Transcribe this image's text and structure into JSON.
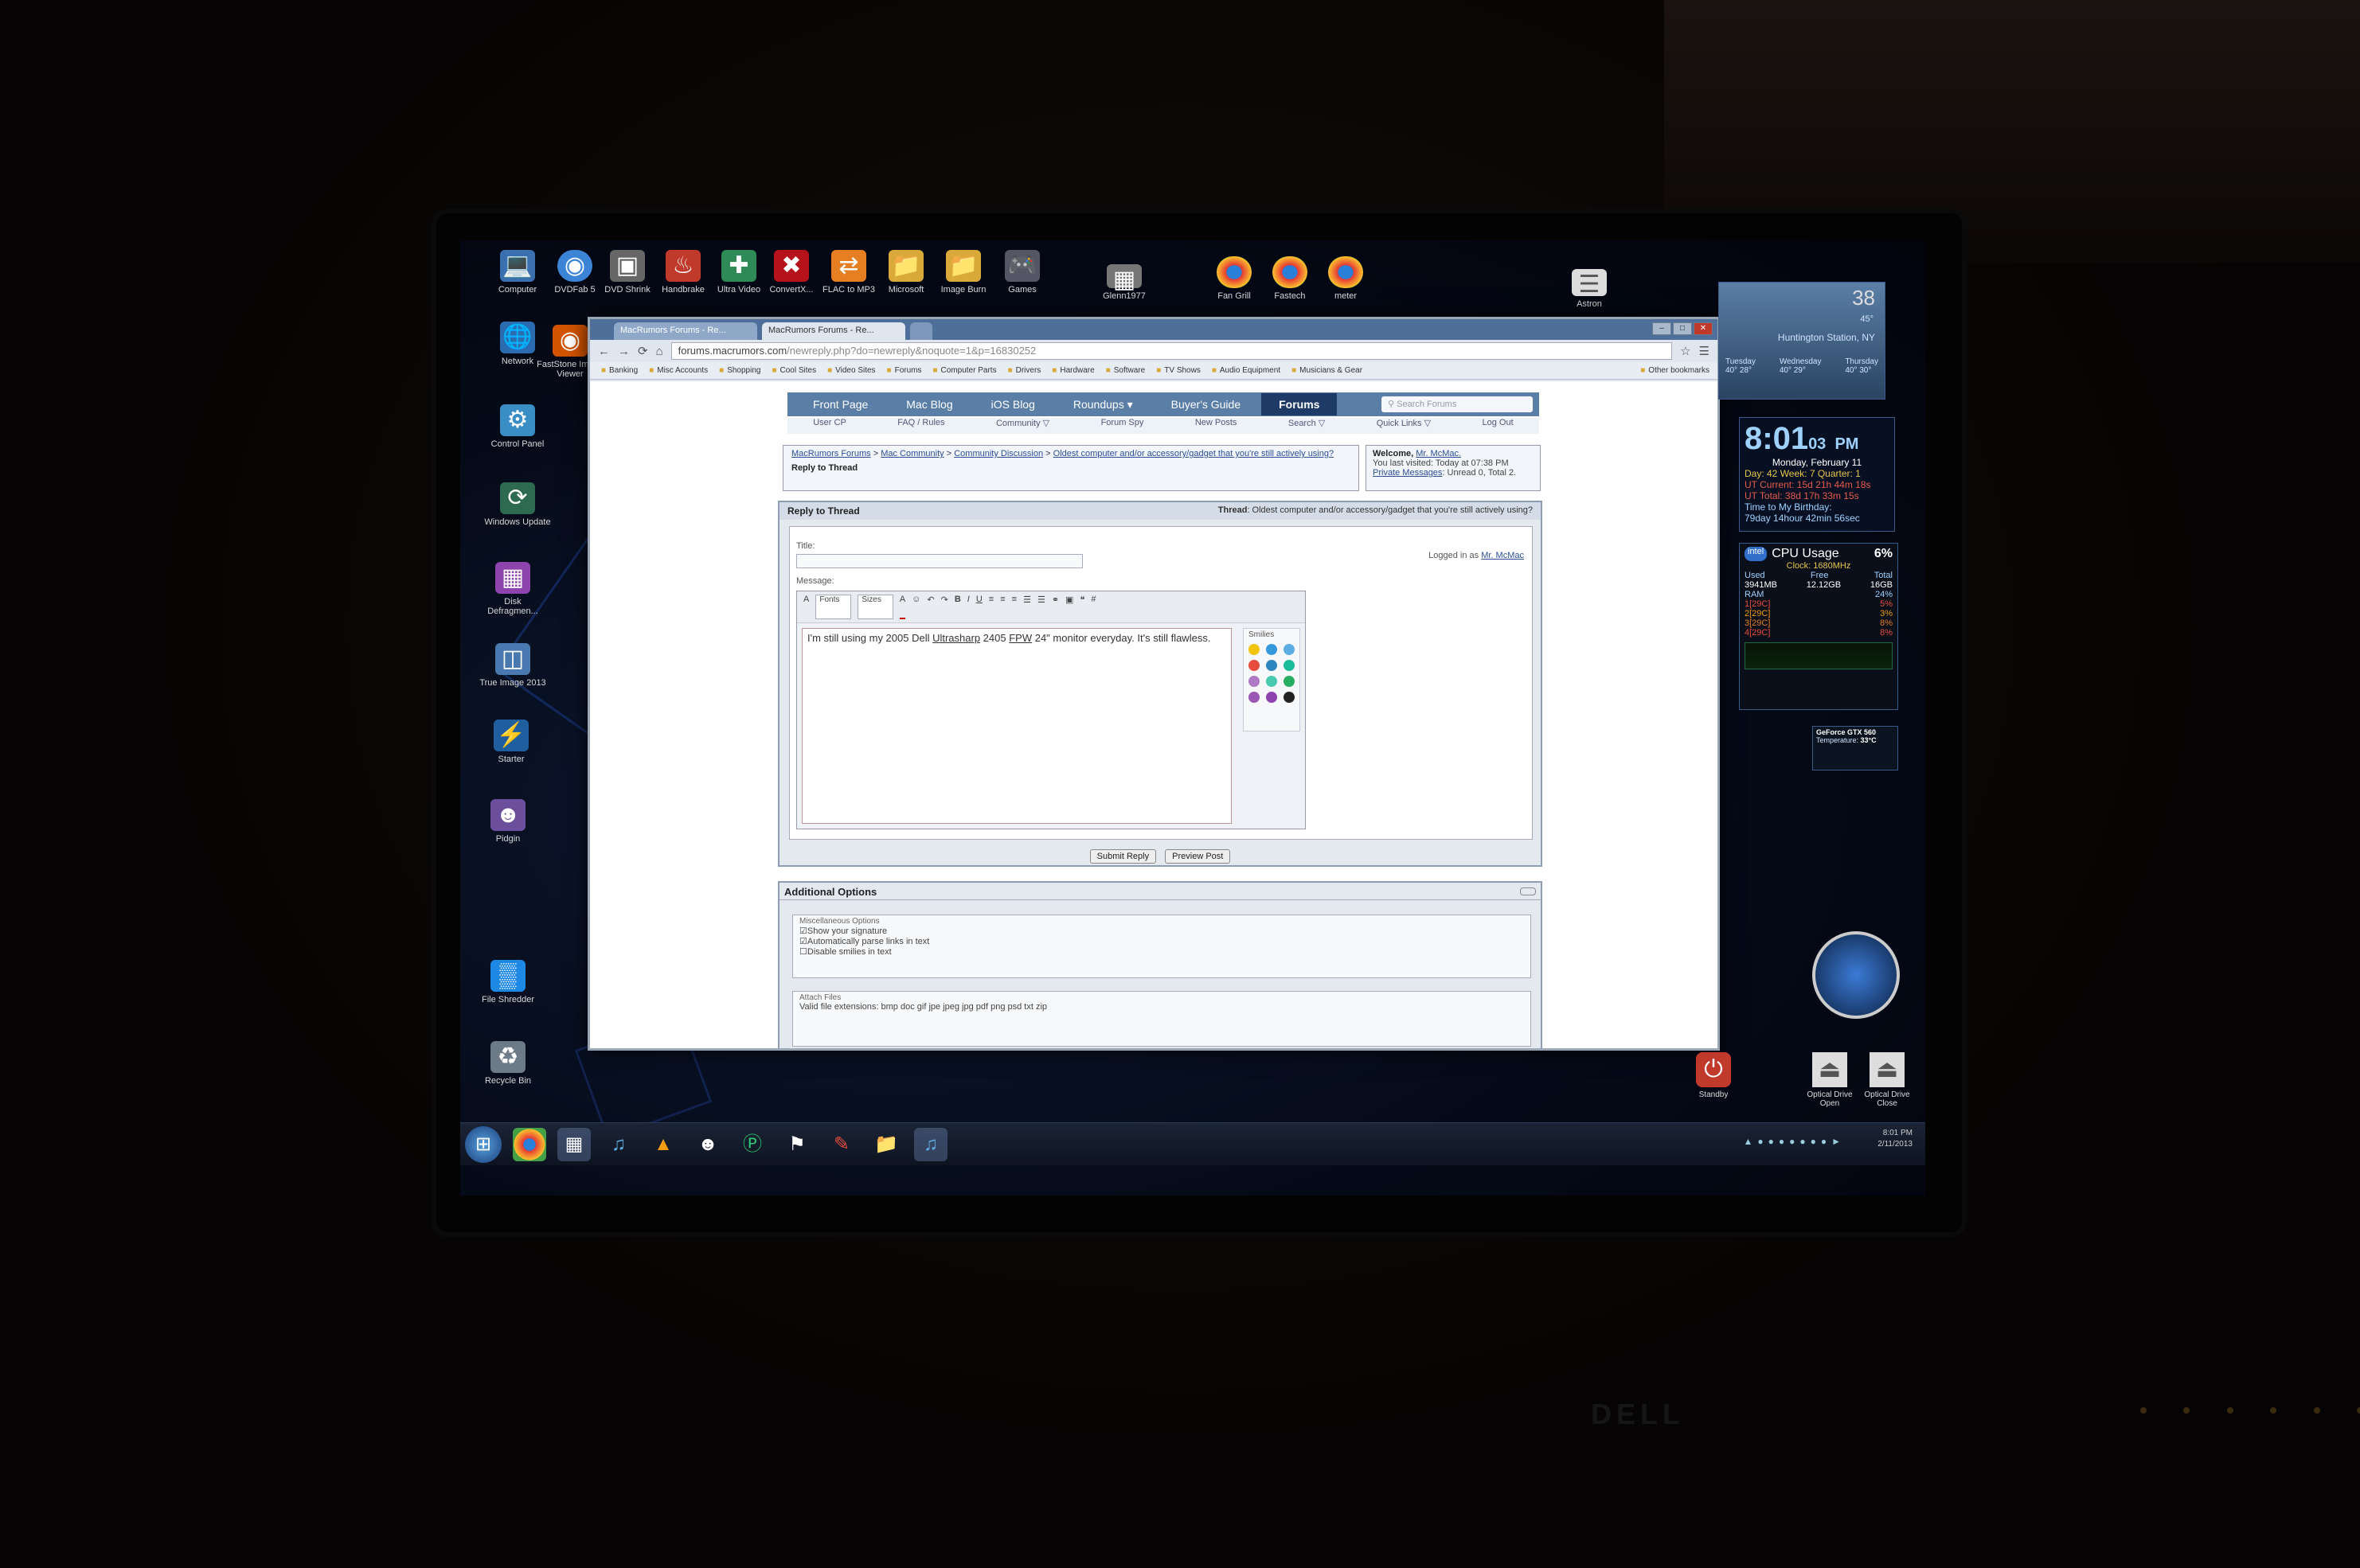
{
  "desktop": {
    "icons_left": [
      {
        "label": "Computer",
        "glyph": "computer-icon"
      },
      {
        "label": "DVDFab 5",
        "glyph": "dvdfab-icon"
      },
      {
        "label": "DVD Shrink",
        "glyph": "dvd-shrink-icon"
      },
      {
        "label": "Handbrake",
        "glyph": "handbrake-icon"
      },
      {
        "label": "Ultra Video",
        "glyph": "ultra-video-icon"
      },
      {
        "label": "ConvertX...",
        "glyph": "convertx-icon"
      },
      {
        "label": "FLAC to MP3",
        "glyph": "flac-icon"
      },
      {
        "label": "Microsoft",
        "glyph": "folder-icon"
      },
      {
        "label": "Image Burn",
        "glyph": "folder-icon"
      },
      {
        "label": "Games",
        "glyph": "games-icon"
      },
      {
        "label": "Glenn1977",
        "glyph": "photo-icon"
      },
      {
        "label": "Fan Grill",
        "glyph": "chrome-icon"
      },
      {
        "label": "Fastech",
        "glyph": "chrome-icon"
      },
      {
        "label": "meter",
        "glyph": "chrome-icon"
      },
      {
        "label": "Astron",
        "glyph": "document-icon"
      },
      {
        "label": "Network",
        "glyph": "network-icon"
      },
      {
        "label": "FastStone Image Viewer",
        "glyph": "faststone-icon"
      },
      {
        "label": "Control Panel",
        "glyph": "control-panel-icon"
      },
      {
        "label": "Windows Update",
        "glyph": "windows-update-icon"
      },
      {
        "label": "Disk Defragmen...",
        "glyph": "defrag-icon"
      },
      {
        "label": "True Image 2013",
        "glyph": "true-image-icon"
      },
      {
        "label": "Starter",
        "glyph": "starter-icon"
      },
      {
        "label": "Pidgin",
        "glyph": "pidgin-icon"
      },
      {
        "label": "File Shredder",
        "glyph": "shredder-icon"
      },
      {
        "label": "Recycle Bin",
        "glyph": "recycle-bin-icon"
      }
    ],
    "icons_right": [
      {
        "label": "Standby",
        "glyph": "power-icon"
      },
      {
        "label": "Optical Drive Open",
        "glyph": "drive-open-icon"
      },
      {
        "label": "Optical Drive Close",
        "glyph": "drive-close-icon"
      }
    ]
  },
  "browser": {
    "tabs": [
      {
        "label": "MacRumors Forums - Re..."
      },
      {
        "label": "MacRumors Forums - Re..."
      }
    ],
    "url_host": "forums.macrumors.com",
    "url_path": "/newreply.php?do=newreply&noquote=1&p=16830252",
    "bookmarks": [
      "Banking",
      "Misc Accounts",
      "Shopping",
      "Cool Sites",
      "Video Sites",
      "Forums",
      "Computer Parts",
      "Drivers",
      "Hardware",
      "Software",
      "TV Shows",
      "Audio Equipment",
      "Musicians & Gear"
    ],
    "other_bookmarks": "Other bookmarks"
  },
  "forum": {
    "nav": [
      "Front Page",
      "Mac Blog",
      "iOS Blog",
      "Roundups ▾",
      "Buyer's Guide",
      "Forums"
    ],
    "search_placeholder": "Search Forums",
    "subnav": [
      "User CP",
      "FAQ / Rules",
      "Community ▽",
      "Forum Spy",
      "New Posts",
      "Search ▽",
      "Quick Links ▽",
      "Log Out"
    ],
    "breadcrumb": [
      "MacRumors Forums",
      "Mac Community",
      "Community Discussion",
      "Oldest computer and/or accessory/gadget that you're still actively using?"
    ],
    "breadcrumb_sep": ">",
    "page_title": "Reply to Thread",
    "welcome_label": "Welcome,",
    "welcome_user": "Mr. McMac.",
    "last_visited": "You last visited: Today at 07:38 PM",
    "private_messages": "Private Messages",
    "pm_status": ": Unread 0, Total 2.",
    "panel_title": "Reply to Thread",
    "thread_label": "Thread",
    "thread_title": ": Oldest computer and/or accessory/gadget that you're still actively using?",
    "title_label": "Title:",
    "logged_in_prefix": "Logged in as",
    "logged_in_user": "Mr. McMac",
    "message_label": "Message:",
    "toolbar_font": "Fonts",
    "toolbar_size": "Sizes",
    "message_a": "I'm still using my 2005 Dell ",
    "message_u1": "Ultrasharp",
    "message_b": " 2405 ",
    "message_u2": "FPW",
    "message_c": " 24\" monitor everyday. It's still flawless.",
    "smilies_label": "Smilies",
    "submit": "Submit Reply",
    "preview": "Preview Post",
    "additional_title": "Additional Options",
    "misc_legend": "Miscellaneous Options",
    "opt1": "Show your signature",
    "opt2": "Automatically parse links in text",
    "opt3": "Disable smilies in text",
    "attach_legend": "Attach Files",
    "attach_ext": "Valid file extensions: bmp doc gif jpe jpeg jpg pdf png psd txt zip"
  },
  "gadgets": {
    "weather_temp": "38",
    "weather_hi": "45°",
    "weather_location": "Huntington Station, NY",
    "weather_days": [
      "Tuesday",
      "Wednesday",
      "Thursday"
    ],
    "weather_highs": [
      "40°",
      "40°",
      "40°"
    ],
    "weather_lows": [
      "28°",
      "29°",
      "30°"
    ],
    "clock_time": "8:01",
    "clock_sec": "03",
    "clock_ampm": "PM",
    "clock_date": "Monday, February 11",
    "clock_days": "Day: 42   Week: 7   Quarter: 1",
    "clock_ut_current": "UT Current: 15d 21h 44m 18s",
    "clock_ut_total": "UT Total: 38d 17h 33m 15s",
    "clock_birthday_label": "Time to My Birthday:",
    "clock_birthday": "79day 14hour 42min 56sec",
    "cpu_brand": "intel",
    "cpu_title": "CPU Usage",
    "cpu_pct": "6%",
    "cpu_clock": "Clock: 1680MHz",
    "ram_headers": [
      "Used",
      "Free",
      "Total"
    ],
    "ram_values": [
      "3941MB",
      "12.12GB",
      "16GB"
    ],
    "ram_label": "RAM",
    "ram_pct": "24%",
    "cores": [
      {
        "label": "1[29C]",
        "pct": "5%"
      },
      {
        "label": "2[29C]",
        "pct": "3%"
      },
      {
        "label": "3[29C]",
        "pct": "8%"
      },
      {
        "label": "4[29C]",
        "pct": "8%"
      }
    ],
    "gpu_name": "GeForce GTX 560",
    "gpu_temp_label": "Temperature:",
    "gpu_temp": "33°C"
  },
  "taskbar": {
    "time": "8:01 PM",
    "date": "2/11/2013"
  },
  "colors": {
    "forum_nav": "#5b7ea6",
    "forum_nav_active": "#1e3a66",
    "taskbar": "#1b2436",
    "clock_digits": "#9fd1ff"
  }
}
